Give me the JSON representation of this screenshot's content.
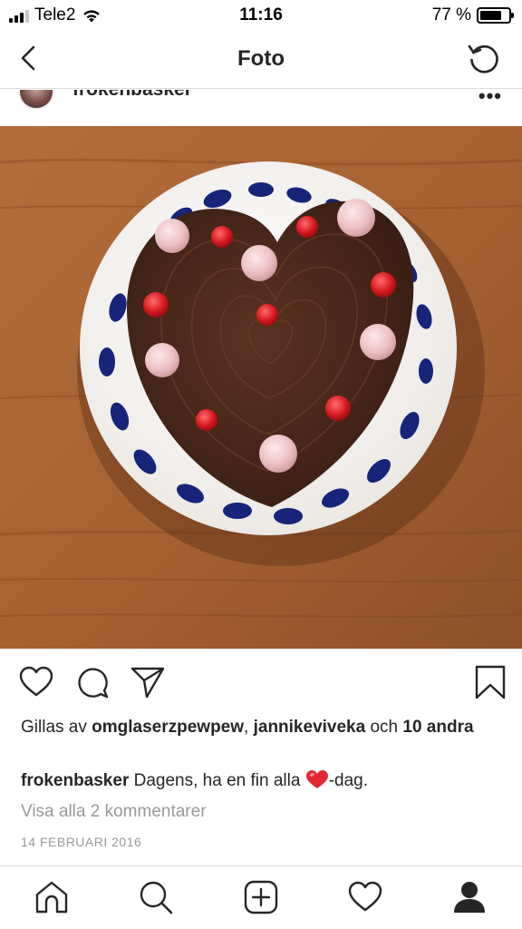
{
  "status": {
    "carrier": "Tele2",
    "time": "11:16",
    "battery": "77 %",
    "battery_level": 0.77
  },
  "nav": {
    "title": "Foto",
    "back_icon": "chevron-left-icon",
    "refresh_icon": "refresh-icon"
  },
  "post": {
    "username": "frokenbasker",
    "more_icon": "more-icon",
    "likes": {
      "prefix": "Gillas av ",
      "user1": "omglaserzpewpew",
      "sep": ", ",
      "user2": "jannikeviveka",
      "and": " och ",
      "others": "10 andra"
    },
    "caption": {
      "user": "frokenbasker",
      "text_before": " Dagens, ha en fin alla ",
      "text_after": "-dag."
    },
    "view_comments": "Visa alla 2 kommentarer",
    "date": "14 FEBRUARI 2016"
  },
  "tabs": [
    "home-icon",
    "search-icon",
    "new-post-icon",
    "activity-icon",
    "profile-icon"
  ],
  "colors": {
    "text": "#262626",
    "muted": "#999999",
    "separator": "#dbdbdb",
    "heart_red": "#e0292f"
  }
}
